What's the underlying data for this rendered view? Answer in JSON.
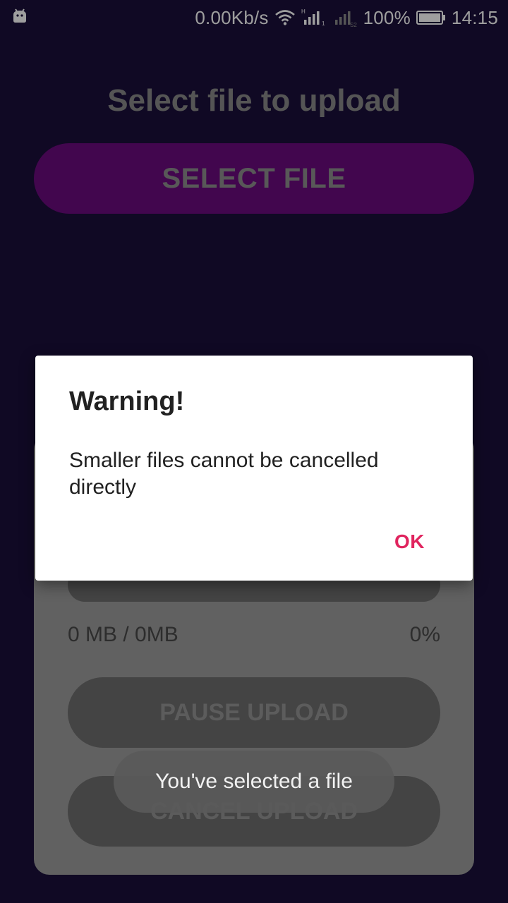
{
  "status_bar": {
    "network_speed": "0.00Kb/s",
    "battery_percent": "100%",
    "time": "14:15",
    "icons": [
      "android-app-icon",
      "wifi-icon",
      "signal-sim1-icon",
      "signal-sim2-icon",
      "battery-icon"
    ]
  },
  "main": {
    "title": "Select file to upload",
    "select_file_label": "SELECT FILE",
    "progress_fraction": 0,
    "size_text": "0 MB / 0MB",
    "percent_text": "0%",
    "pause_label": "PAUSE UPLOAD",
    "cancel_label": "CANCEL UPLOAD"
  },
  "dialog": {
    "title": "Warning!",
    "message": "Smaller files cannot be cancelled directly",
    "ok_label": "OK"
  },
  "toast": {
    "text": "You've selected a file"
  },
  "colors": {
    "background": "#1a0f3a",
    "select_button": "#6b0a7e",
    "dialog_accent": "#e0245e"
  }
}
